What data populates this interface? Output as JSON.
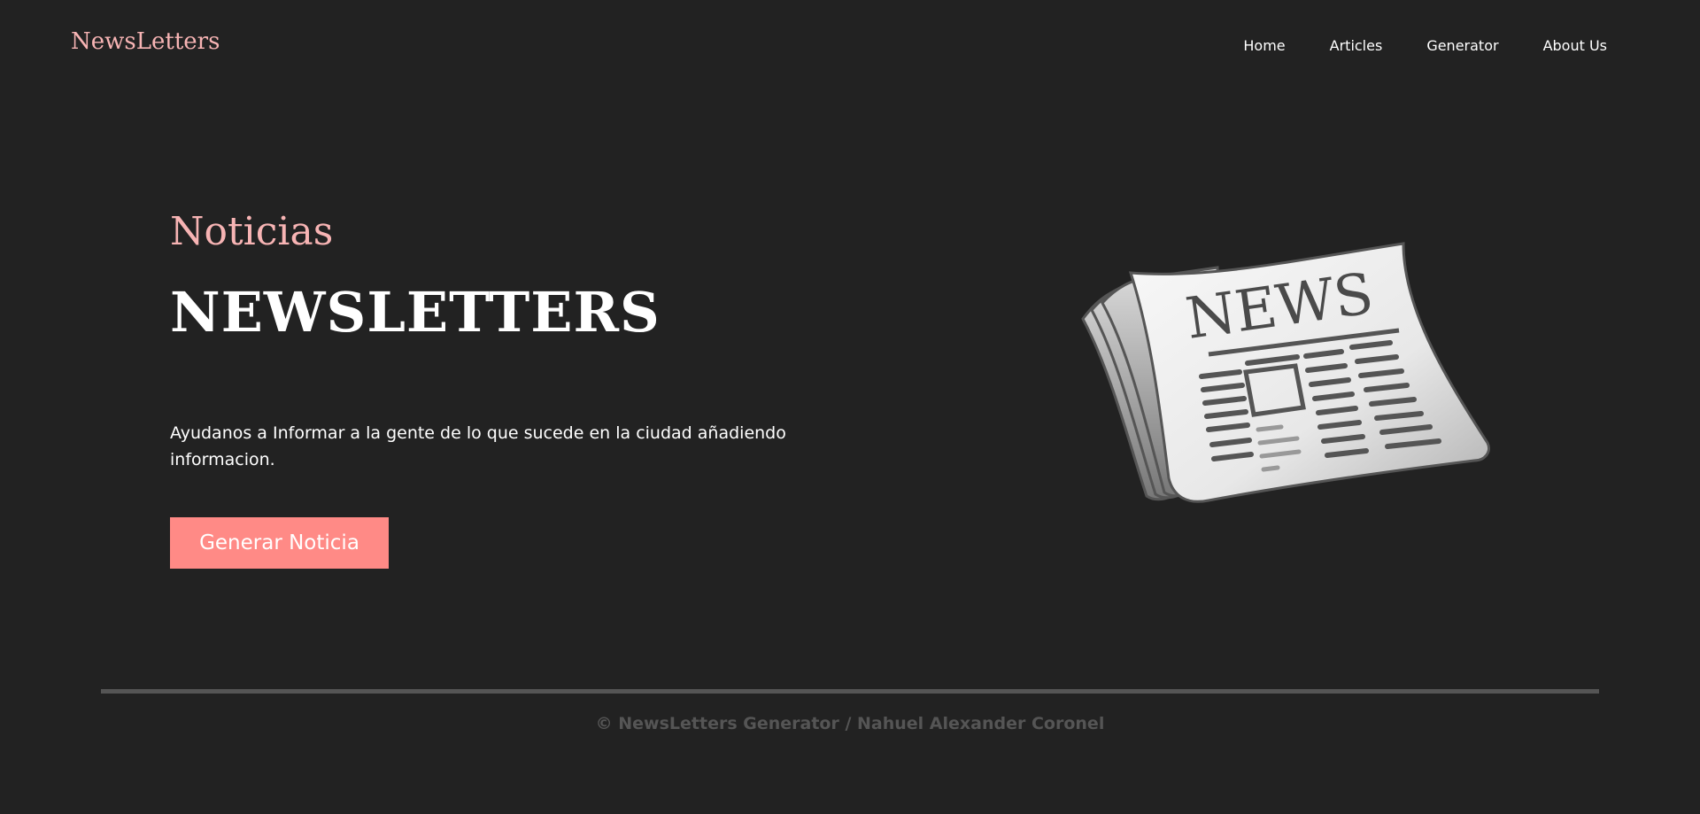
{
  "header": {
    "brand": "NewsLetters",
    "nav": [
      {
        "label": "Home"
      },
      {
        "label": "Articles"
      },
      {
        "label": "Generator"
      },
      {
        "label": "About Us"
      }
    ]
  },
  "hero": {
    "subtitle": "Noticias",
    "title": "NEWSLETTERS",
    "description": "Ayudanos a Informar a la gente de lo que sucede en la ciudad añadiendo informacion.",
    "cta_label": "Generar Noticia",
    "illustration": {
      "icon": "newspaper-icon",
      "headline": "NEWS"
    }
  },
  "footer": {
    "text": "© NewsLetters Generator / Nahuel Alexander Coronel"
  },
  "colors": {
    "background": "#222222",
    "accent_pink": "#f7b4b4",
    "button": "#ff8a86",
    "divider": "#555555",
    "footer_text": "#555555"
  }
}
